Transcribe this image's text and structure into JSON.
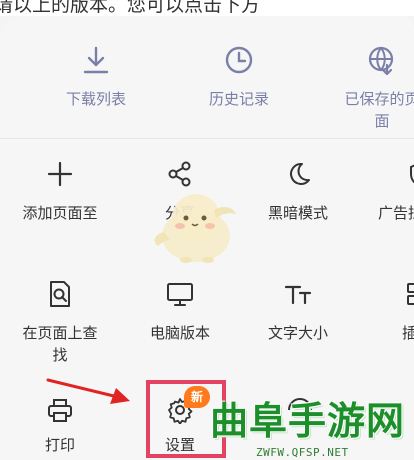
{
  "background_text": "请以上的版本。您可以点击下方",
  "top_row": [
    {
      "label": "下载列表",
      "icon": "download-icon"
    },
    {
      "label": "历史记录",
      "icon": "clock-icon"
    },
    {
      "label": "已保存的页\n面",
      "icon": "saved-page-globe-icon"
    }
  ],
  "row1": [
    {
      "label": "添加页面至",
      "icon": "plus-icon"
    },
    {
      "label": "分享",
      "icon": "share-icon"
    },
    {
      "label": "黑暗模式",
      "icon": "moon-icon"
    },
    {
      "label": "广告拦",
      "icon": "shield-icon"
    }
  ],
  "row2": [
    {
      "label": "在页面上查\n找",
      "icon": "find-in-page-icon"
    },
    {
      "label": "电脑版本",
      "icon": "desktop-icon"
    },
    {
      "label": "文字大小",
      "icon": "text-size-icon"
    },
    {
      "label": "插",
      "icon": "extension-icon"
    }
  ],
  "row3": [
    {
      "label": "打印",
      "icon": "printer-icon"
    },
    {
      "label": "设置",
      "icon": "gear-icon",
      "badge": "新"
    }
  ],
  "watermark": {
    "title": "曲阜手游网",
    "url": "ZWFW.QFSP.NET"
  },
  "colors": {
    "top_row_text": "#7a7fa8",
    "highlight": "#e34262",
    "badge": "#ff7a1a",
    "watermark": "#1d8f2a"
  }
}
